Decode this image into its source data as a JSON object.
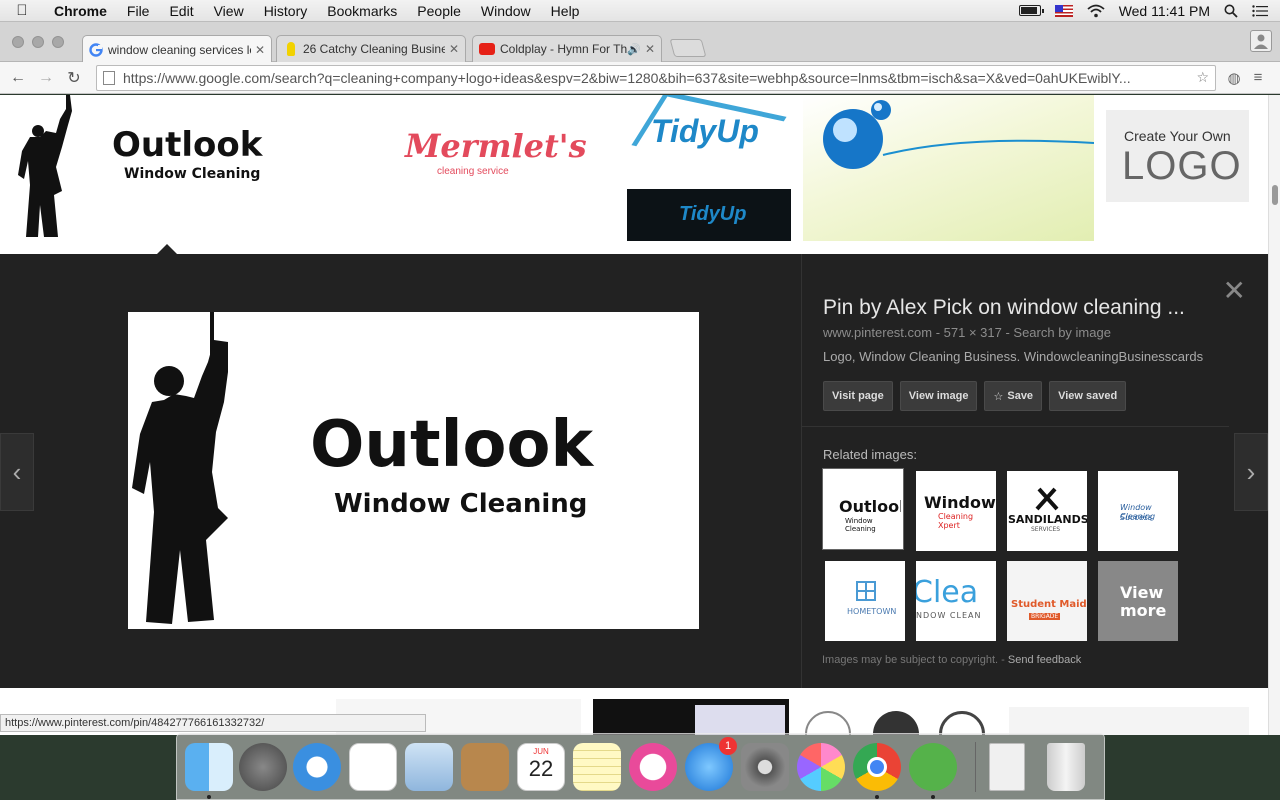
{
  "menubar": {
    "app_name": "Chrome",
    "items": [
      "File",
      "Edit",
      "View",
      "History",
      "Bookmarks",
      "People",
      "Window",
      "Help"
    ],
    "clock": "Wed 11:41 PM"
  },
  "tabs": [
    {
      "title": "window cleaning services lo",
      "active": true
    },
    {
      "title": "26 Catchy Cleaning Busine",
      "active": false
    },
    {
      "title": "Coldplay - Hymn For The",
      "active": false
    }
  ],
  "address_bar": {
    "url": "https://www.google.com/search?q=cleaning+company+logo+ideas&espv=2&biw=1280&bih=637&site=webhp&source=lnms&tbm=isch&sa=X&ved=0ahUKEwiblY..."
  },
  "results_row": {
    "outlook": {
      "word": "Outlook",
      "sub": "Window Cleaning"
    },
    "mermlets": {
      "word": "Mermlet's",
      "sub": "cleaning service"
    },
    "tidyup": {
      "word": "TidyUp"
    },
    "create_logo": {
      "line1": "Create Your Own",
      "line2": "LOGO"
    }
  },
  "preview": {
    "word": "Outlook",
    "sub": "Window Cleaning",
    "title": "Pin by Alex Pick on window cleaning ...",
    "meta": "www.pinterest.com - 571 × 317 - Search by image",
    "description": "Logo, Window Cleaning Business. WindowcleaningBusinesscards",
    "buttons": {
      "visit": "Visit page",
      "view": "View image",
      "save": "Save",
      "saved": "View saved"
    },
    "related_label": "Related images:",
    "related": [
      {
        "line1": "Outlook",
        "line2": "Window Cleaning"
      },
      {
        "line1": "Window",
        "line2": "Cleaning Xpert"
      },
      {
        "line1": "SANDILANDS",
        "line2": "SERVICES"
      },
      {
        "line1": "Window Cleaning",
        "line2": "Success"
      },
      {
        "line1": "HOMETOWN",
        "line2": ""
      },
      {
        "line1": "Clea",
        "line2": "NDOW CLEAN"
      },
      {
        "line1": "Student Maid",
        "line2": "BRIGADE"
      },
      {
        "line1": "View",
        "line2": "more"
      }
    ],
    "copyright": "Images may be subject to copyright.",
    "feedback": "Send feedback"
  },
  "status_url": "https://www.pinterest.com/pin/484277766161332732/",
  "dock": {
    "appstore_badge": "1",
    "calendar_month": "JUN",
    "calendar_day": "22"
  }
}
